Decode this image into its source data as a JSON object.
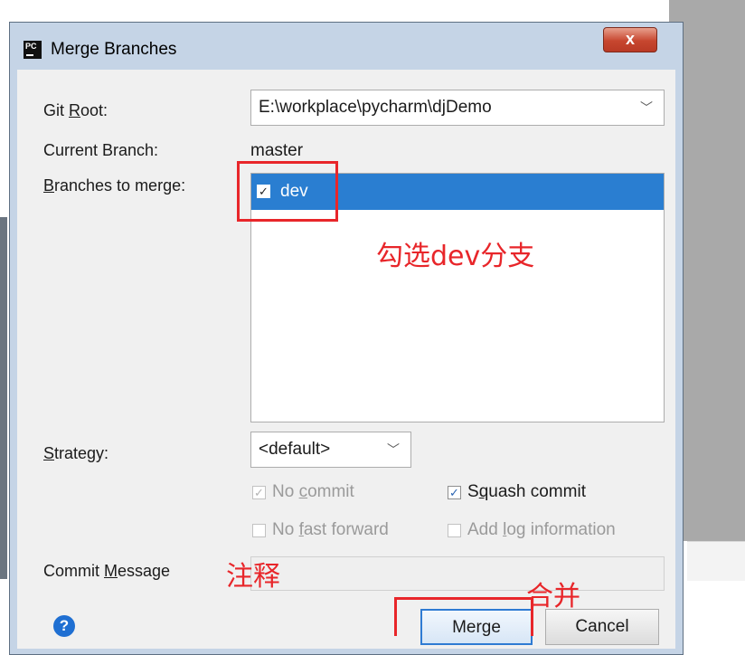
{
  "window": {
    "title": "Merge Branches",
    "icon": "pycharm-icon",
    "close_label": "x"
  },
  "form": {
    "git_root_label_pre": "Git ",
    "git_root_label_mnemonic": "R",
    "git_root_label_post": "oot:",
    "git_root_value": "E:\\workplace\\pycharm\\djDemo",
    "current_branch_label": "Current Branch:",
    "current_branch_value": "master",
    "branches_label_mnemonic": "B",
    "branches_label_post": "ranches to merge:",
    "branches": [
      {
        "name": "dev",
        "checked": true,
        "selected": true
      }
    ],
    "strategy_label_mnemonic": "S",
    "strategy_label_post": "trategy:",
    "strategy_value": "<default>",
    "options": {
      "no_commit_pre": "No ",
      "no_commit_mnemonic": "c",
      "no_commit_post": "ommit",
      "squash_pre": "S",
      "squash_mnemonic": "q",
      "squash_post": "uash commit",
      "no_ff_pre": "No ",
      "no_ff_mnemonic": "f",
      "no_ff_post": "ast forward",
      "add_log_pre": "Add ",
      "add_log_mnemonic": "l",
      "add_log_post": "og information"
    },
    "commit_message_label_pre": "Commit ",
    "commit_message_label_mnemonic": "M",
    "commit_message_label_post": "essage",
    "commit_message_value": ""
  },
  "buttons": {
    "merge": "Merge",
    "cancel": "Cancel",
    "help": "?"
  },
  "annotations": {
    "check_dev": "勾选dev分支",
    "comment": "注释",
    "merge": "合并"
  },
  "colors": {
    "selection": "#2a7ed1",
    "annotation_red": "#e8262a",
    "primary_border": "#2f7bd3"
  }
}
